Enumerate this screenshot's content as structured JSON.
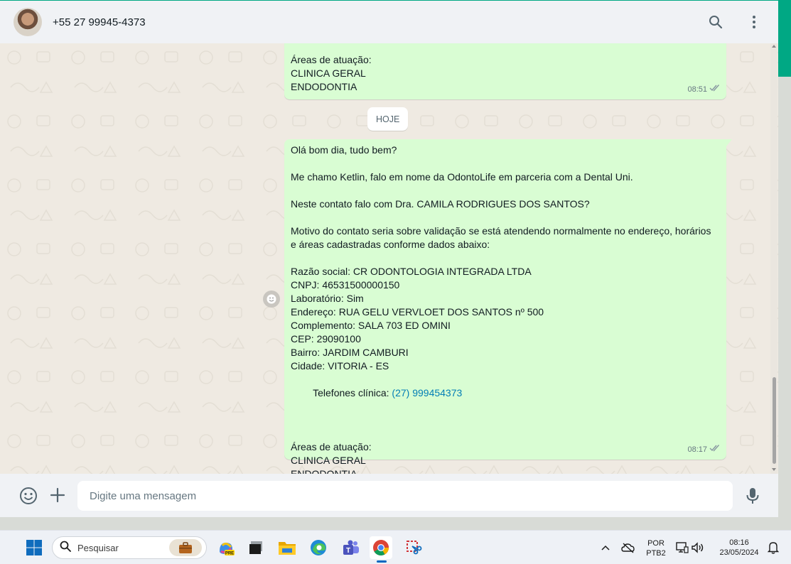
{
  "header": {
    "contact_name": "+55 27 99945-4373"
  },
  "messages": [
    {
      "lines": [
        "Áreas de atuação:",
        "CLINICA GERAL",
        "ENDODONTIA"
      ],
      "time": "08:51"
    },
    {
      "lines": [
        "Olá bom dia, tudo bem?",
        "",
        "Me chamo Ketlin, falo em nome da OdontoLife em parceria com a Dental Uni.",
        "",
        "Neste contato falo com Dra. CAMILA RODRIGUES DOS SANTOS?",
        "",
        "Motivo do contato seria sobre validação se está atendendo normalmente no endereço, horários",
        "e áreas cadastradas conforme dados abaixo:",
        "",
        "Razão social: CR ODONTOLOGIA INTEGRADA LTDA",
        "CNPJ: 46531500000150",
        "Laboratório: Sim",
        "Endereço: RUA GELU VERVLOET DOS SANTOS nº 500",
        "Complemento: SALA 703 ED OMINI",
        "CEP: 29090100",
        "Bairro: JARDIM CAMBURI",
        "Cidade: VITORIA - ES"
      ],
      "phone_label": "Telefones clínica: ",
      "phone_link": "(27) 999454373",
      "tail_lines": [
        "",
        "",
        "Áreas de atuação:",
        "CLINICA GERAL",
        "ENDODONTIA"
      ],
      "time": "08:17"
    }
  ],
  "date_chip": "HOJE",
  "composer": {
    "placeholder": "Digite uma mensagem"
  },
  "taskbar": {
    "search_label": "Pesquisar",
    "lang_top": "POR",
    "lang_bottom": "PTB2",
    "time": "08:16",
    "date": "23/05/2024"
  },
  "colors": {
    "outgoing_bubble": "#d9fdd3",
    "chat_bg": "#efeae2",
    "header_bg": "#f0f2f5",
    "accent": "#00a884",
    "link": "#027eb5"
  }
}
